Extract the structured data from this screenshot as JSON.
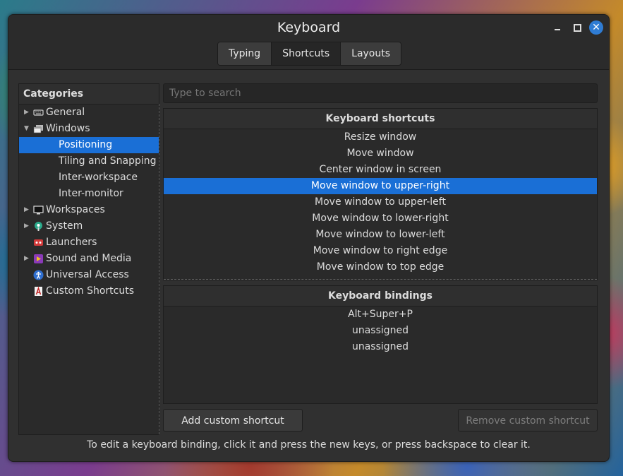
{
  "window": {
    "title": "Keyboard",
    "controls": {
      "minimize": "minimize",
      "maximize": "maximize",
      "close": "✕"
    }
  },
  "tabs": [
    {
      "label": "Typing",
      "active": false
    },
    {
      "label": "Shortcuts",
      "active": true
    },
    {
      "label": "Layouts",
      "active": false
    }
  ],
  "sidebar": {
    "header": "Categories",
    "items": [
      {
        "label": "General",
        "icon": "keyboard-icon",
        "expander": "▶",
        "selected": false
      },
      {
        "label": "Windows",
        "icon": "window-icon",
        "expander": "▼",
        "selected": false
      },
      {
        "label": "Positioning",
        "selected": true
      },
      {
        "label": "Tiling and Snapping",
        "selected": false
      },
      {
        "label": "Inter-workspace",
        "selected": false
      },
      {
        "label": "Inter-monitor",
        "selected": false
      },
      {
        "label": "Workspaces",
        "icon": "monitor-icon",
        "expander": "▶",
        "selected": false
      },
      {
        "label": "System",
        "icon": "system-icon",
        "expander": "▶",
        "selected": false
      },
      {
        "label": "Launchers",
        "icon": "launcher-icon",
        "selected": false
      },
      {
        "label": "Sound and Media",
        "icon": "media-icon",
        "expander": "▶",
        "selected": false
      },
      {
        "label": "Universal Access",
        "icon": "accessibility-icon",
        "selected": false
      },
      {
        "label": "Custom Shortcuts",
        "icon": "custom-shortcut-icon",
        "selected": false
      }
    ]
  },
  "search": {
    "placeholder": "Type to search"
  },
  "shortcuts": {
    "header": "Keyboard shortcuts",
    "rows": [
      "Resize window",
      "Move window",
      "Center window in screen",
      "Move window to upper-right",
      "Move window to upper-left",
      "Move window to lower-right",
      "Move window to lower-left",
      "Move window to right edge",
      "Move window to top edge"
    ],
    "selected_index": 3
  },
  "bindings": {
    "header": "Keyboard bindings",
    "rows": [
      "Alt+Super+P",
      "unassigned",
      "unassigned"
    ]
  },
  "buttons": {
    "add": "Add custom shortcut",
    "remove": "Remove custom shortcut"
  },
  "hint": "To edit a keyboard binding, click it and press the new keys, or press backspace to clear it.",
  "colors": {
    "accent": "#1a6fd6",
    "close_button": "#2f7cd3"
  }
}
